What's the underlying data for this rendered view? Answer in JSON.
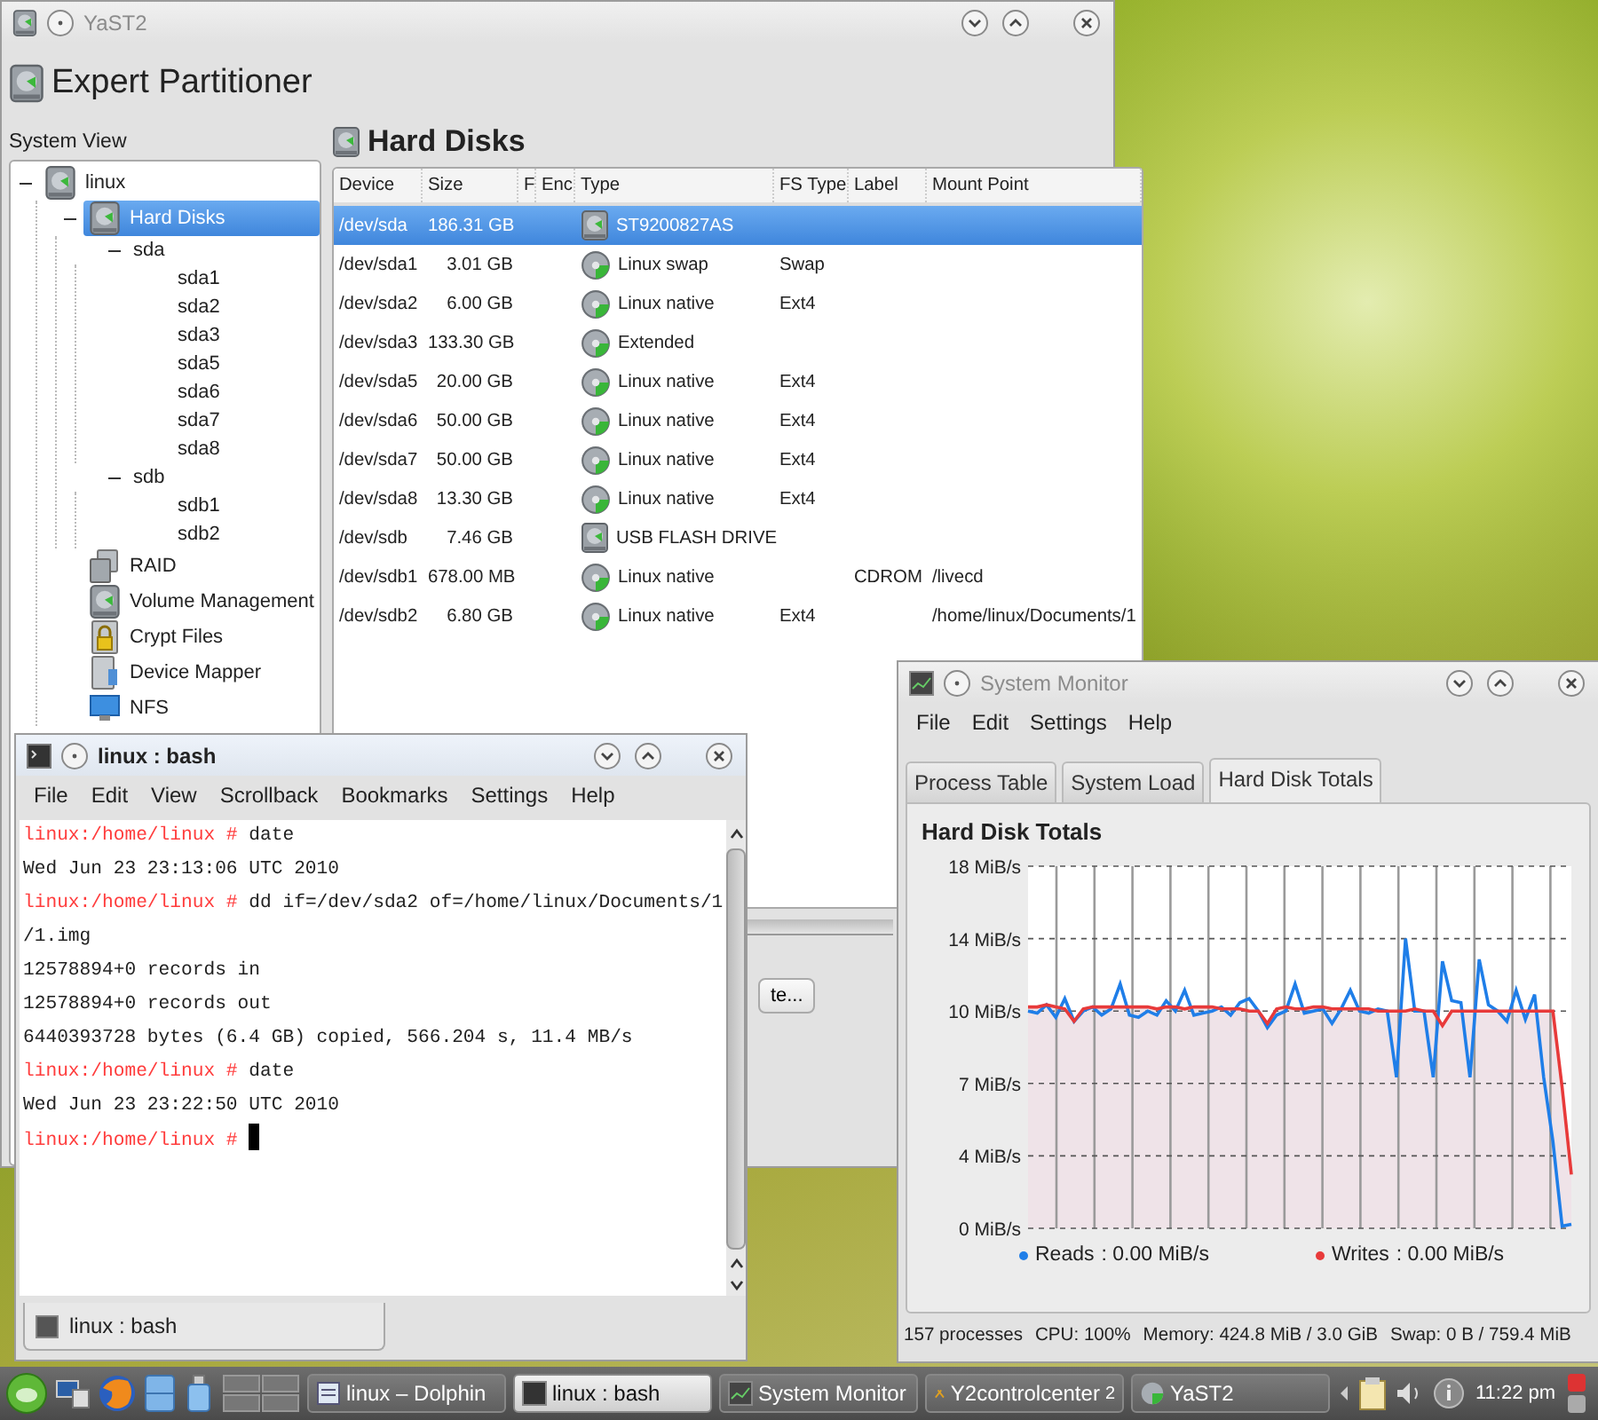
{
  "yast": {
    "title": "YaST2",
    "heading": "Expert Partitioner",
    "tree_label": "System View",
    "tree": [
      {
        "label": "linux",
        "kind": "computer",
        "expanded": true,
        "selected": false,
        "children": [
          {
            "label": "Hard Disks",
            "kind": "disks",
            "expanded": true,
            "selected": true,
            "children": [
              {
                "label": "sda",
                "kind": "device",
                "expanded": true,
                "selected": false,
                "children": [
                  {
                    "label": "sda1",
                    "kind": "partition",
                    "selected": false
                  },
                  {
                    "label": "sda2",
                    "kind": "partition",
                    "selected": false
                  },
                  {
                    "label": "sda3",
                    "kind": "partition",
                    "selected": false
                  },
                  {
                    "label": "sda5",
                    "kind": "partition",
                    "selected": false
                  },
                  {
                    "label": "sda6",
                    "kind": "partition",
                    "selected": false
                  },
                  {
                    "label": "sda7",
                    "kind": "partition",
                    "selected": false
                  },
                  {
                    "label": "sda8",
                    "kind": "partition",
                    "selected": false
                  }
                ]
              },
              {
                "label": "sdb",
                "kind": "device",
                "expanded": true,
                "selected": false,
                "children": [
                  {
                    "label": "sdb1",
                    "kind": "partition",
                    "selected": false
                  },
                  {
                    "label": "sdb2",
                    "kind": "partition",
                    "selected": false
                  }
                ]
              }
            ]
          },
          {
            "label": "RAID",
            "kind": "raid",
            "selected": false
          },
          {
            "label": "Volume Management",
            "kind": "volume",
            "selected": false
          },
          {
            "label": "Crypt Files",
            "kind": "crypt",
            "selected": false
          },
          {
            "label": "Device Mapper",
            "kind": "mapper",
            "selected": false
          },
          {
            "label": "NFS",
            "kind": "nfs",
            "selected": false
          }
        ]
      }
    ],
    "panel_title": "Hard Disks",
    "table": {
      "columns": [
        "Device",
        "Size",
        "F",
        "Enc",
        "Type",
        "FS Type",
        "Label",
        "Mount Point"
      ],
      "rows": [
        {
          "kind": "disk",
          "selected": true,
          "device": "/dev/sda",
          "size": "186.31 GB",
          "type": "ST9200827AS"
        },
        {
          "kind": "partition",
          "selected": false,
          "device": "/dev/sda1",
          "size": "3.01 GB",
          "type": "Linux swap",
          "fs_type": "Swap"
        },
        {
          "kind": "partition",
          "selected": false,
          "device": "/dev/sda2",
          "size": "6.00 GB",
          "type": "Linux native",
          "fs_type": "Ext4"
        },
        {
          "kind": "partition",
          "selected": false,
          "device": "/dev/sda3",
          "size": "133.30 GB",
          "type": "Extended"
        },
        {
          "kind": "partition",
          "selected": false,
          "device": "/dev/sda5",
          "size": "20.00 GB",
          "type": "Linux native",
          "fs_type": "Ext4"
        },
        {
          "kind": "partition",
          "selected": false,
          "device": "/dev/sda6",
          "size": "50.00 GB",
          "type": "Linux native",
          "fs_type": "Ext4"
        },
        {
          "kind": "partition",
          "selected": false,
          "device": "/dev/sda7",
          "size": "50.00 GB",
          "type": "Linux native",
          "fs_type": "Ext4"
        },
        {
          "kind": "partition",
          "selected": false,
          "device": "/dev/sda8",
          "size": "13.30 GB",
          "type": "Linux native",
          "fs_type": "Ext4"
        },
        {
          "kind": "disk",
          "selected": false,
          "device": "/dev/sdb",
          "size": "7.46 GB",
          "type": "USB FLASH DRIVE"
        },
        {
          "kind": "partition",
          "selected": false,
          "device": "/dev/sdb1",
          "size": "678.00 MB",
          "type": "Linux native",
          "label": "CDROM",
          "mount_point": "/livecd"
        },
        {
          "kind": "partition",
          "selected": false,
          "device": "/dev/sdb2",
          "size": "6.80 GB",
          "type": "Linux native",
          "fs_type": "Ext4",
          "mount_point": "/home/linux/Documents/1"
        }
      ]
    },
    "button_fragment": "te..."
  },
  "terminal": {
    "title": "linux : bash",
    "menu": [
      "File",
      "Edit",
      "View",
      "Scrollback",
      "Bookmarks",
      "Settings",
      "Help"
    ],
    "lines": [
      {
        "prompt": "linux:/home/linux #",
        "text": "date"
      },
      {
        "text": "Wed Jun 23 23:13:06 UTC 2010"
      },
      {
        "prompt": "linux:/home/linux #",
        "text": "dd if=/dev/sda2 of=/home/linux/Documents/1"
      },
      {
        "text": "/1.img"
      },
      {
        "text": "12578894+0 records in"
      },
      {
        "text": "12578894+0 records out"
      },
      {
        "text": "6440393728 bytes (6.4 GB) copied, 566.204 s, 11.4 MB/s"
      },
      {
        "prompt": "linux:/home/linux #",
        "text": "date"
      },
      {
        "text": "Wed Jun 23 23:22:50 UTC 2010"
      },
      {
        "prompt": "linux:/home/linux #",
        "cursor": true
      }
    ],
    "session_tab": "linux : bash"
  },
  "system_monitor": {
    "title": "System Monitor",
    "menu": [
      "File",
      "Edit",
      "Settings",
      "Help"
    ],
    "tabs": [
      {
        "label": "Process Table",
        "selected": false
      },
      {
        "label": "System Load",
        "selected": false
      },
      {
        "label": "Hard Disk Totals",
        "selected": true
      }
    ],
    "panel_title": "Hard Disk Totals",
    "chart_data": {
      "type": "line",
      "ylim": [
        0,
        17.5
      ],
      "grid": true,
      "yticks": [
        {
          "value": 0,
          "label": "0 MiB/s"
        },
        {
          "value": 3.5,
          "label": "4 MiB/s"
        },
        {
          "value": 7,
          "label": "7 MiB/s"
        },
        {
          "value": 10.5,
          "label": "10 MiB/s"
        },
        {
          "value": 14,
          "label": "14 MiB/s"
        },
        {
          "value": 17.5,
          "label": "18 MiB/s"
        }
      ],
      "series": [
        {
          "name": "Reads",
          "color": "#1f7ee8",
          "values": [
            10.5,
            10.4,
            10.8,
            10.2,
            11.1,
            10,
            10.5,
            10.7,
            10.3,
            10.6,
            11.8,
            10.3,
            10.2,
            10.5,
            10.3,
            11,
            10.5,
            11.5,
            10.3,
            10.4,
            10.5,
            10.7,
            10.3,
            10.9,
            11.1,
            10.5,
            9.7,
            10.3,
            10.5,
            11.8,
            10.4,
            10.5,
            10.6,
            9.9,
            10.6,
            11.5,
            10.5,
            10.4,
            10.6,
            10.5,
            7.3,
            14,
            10.5,
            10.5,
            7.3,
            12.9,
            11,
            10.9,
            7.3,
            13,
            10.8,
            10.5,
            10,
            11.5,
            10.1,
            11.3,
            7.3,
            4.2,
            0.1,
            0.2
          ]
        },
        {
          "name": "Writes",
          "color": "#e83a3a",
          "values": [
            10.7,
            10.7,
            10.8,
            10.7,
            10.6,
            10,
            10.6,
            10.7,
            10.7,
            10.7,
            10.7,
            10.7,
            10.7,
            10.7,
            10.6,
            10.7,
            10.7,
            10.6,
            10.7,
            10.7,
            10.7,
            10.6,
            10.6,
            10.6,
            10.5,
            10.5,
            9.9,
            10.6,
            10.7,
            10.6,
            10.6,
            10.7,
            10.7,
            10.6,
            10.6,
            10.6,
            10.6,
            10.6,
            10.5,
            10.5,
            10.5,
            10.5,
            10.6,
            10.5,
            10.5,
            9.8,
            10.5,
            10.5,
            10.5,
            10.5,
            10.5,
            10.5,
            10.5,
            10.5,
            10.5,
            10.5,
            10.5,
            10.5,
            6.8,
            2.6
          ]
        }
      ]
    },
    "legend": [
      {
        "reading": ": 0.00 MiB/s"
      },
      {
        "reading": ": 0.00 MiB/s"
      }
    ],
    "status_bar": [
      "157 processes",
      "CPU: 100%",
      "Memory: 424.8 MiB / 3.0 GiB",
      "Swap: 0 B / 759.4 MiB"
    ]
  },
  "taskbar": {
    "tasks": [
      {
        "label": "linux – Dolphin",
        "kind": "files",
        "selected": false
      },
      {
        "label": "linux : bash",
        "kind": "terminal",
        "selected": true
      },
      {
        "label": "System Monitor",
        "kind": "monitor",
        "selected": false
      },
      {
        "label": "Y2controlcenter",
        "kind": "control",
        "selected": false,
        "count": "2"
      },
      {
        "label": "YaST2",
        "kind": "yast",
        "selected": false
      }
    ],
    "clock": "11:22 pm"
  }
}
